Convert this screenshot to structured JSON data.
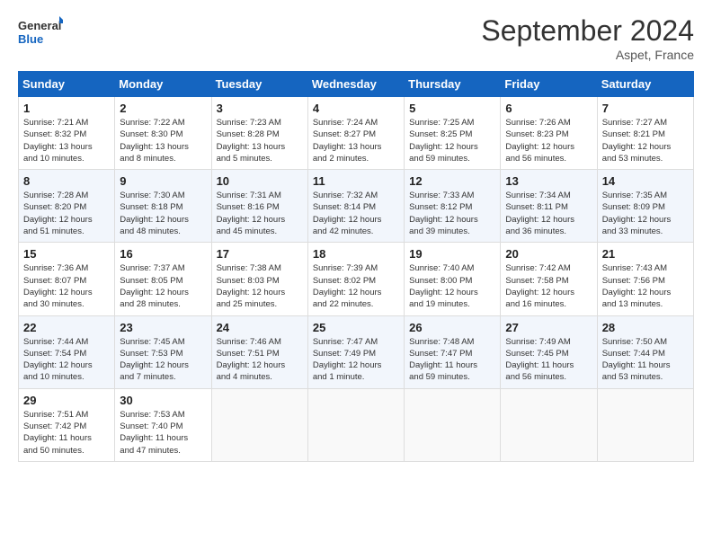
{
  "logo": {
    "line1": "General",
    "line2": "Blue"
  },
  "title": "September 2024",
  "location": "Aspet, France",
  "days_of_week": [
    "Sunday",
    "Monday",
    "Tuesday",
    "Wednesday",
    "Thursday",
    "Friday",
    "Saturday"
  ],
  "weeks": [
    [
      {
        "day": "1",
        "info": "Sunrise: 7:21 AM\nSunset: 8:32 PM\nDaylight: 13 hours\nand 10 minutes."
      },
      {
        "day": "2",
        "info": "Sunrise: 7:22 AM\nSunset: 8:30 PM\nDaylight: 13 hours\nand 8 minutes."
      },
      {
        "day": "3",
        "info": "Sunrise: 7:23 AM\nSunset: 8:28 PM\nDaylight: 13 hours\nand 5 minutes."
      },
      {
        "day": "4",
        "info": "Sunrise: 7:24 AM\nSunset: 8:27 PM\nDaylight: 13 hours\nand 2 minutes."
      },
      {
        "day": "5",
        "info": "Sunrise: 7:25 AM\nSunset: 8:25 PM\nDaylight: 12 hours\nand 59 minutes."
      },
      {
        "day": "6",
        "info": "Sunrise: 7:26 AM\nSunset: 8:23 PM\nDaylight: 12 hours\nand 56 minutes."
      },
      {
        "day": "7",
        "info": "Sunrise: 7:27 AM\nSunset: 8:21 PM\nDaylight: 12 hours\nand 53 minutes."
      }
    ],
    [
      {
        "day": "8",
        "info": "Sunrise: 7:28 AM\nSunset: 8:20 PM\nDaylight: 12 hours\nand 51 minutes."
      },
      {
        "day": "9",
        "info": "Sunrise: 7:30 AM\nSunset: 8:18 PM\nDaylight: 12 hours\nand 48 minutes."
      },
      {
        "day": "10",
        "info": "Sunrise: 7:31 AM\nSunset: 8:16 PM\nDaylight: 12 hours\nand 45 minutes."
      },
      {
        "day": "11",
        "info": "Sunrise: 7:32 AM\nSunset: 8:14 PM\nDaylight: 12 hours\nand 42 minutes."
      },
      {
        "day": "12",
        "info": "Sunrise: 7:33 AM\nSunset: 8:12 PM\nDaylight: 12 hours\nand 39 minutes."
      },
      {
        "day": "13",
        "info": "Sunrise: 7:34 AM\nSunset: 8:11 PM\nDaylight: 12 hours\nand 36 minutes."
      },
      {
        "day": "14",
        "info": "Sunrise: 7:35 AM\nSunset: 8:09 PM\nDaylight: 12 hours\nand 33 minutes."
      }
    ],
    [
      {
        "day": "15",
        "info": "Sunrise: 7:36 AM\nSunset: 8:07 PM\nDaylight: 12 hours\nand 30 minutes."
      },
      {
        "day": "16",
        "info": "Sunrise: 7:37 AM\nSunset: 8:05 PM\nDaylight: 12 hours\nand 28 minutes."
      },
      {
        "day": "17",
        "info": "Sunrise: 7:38 AM\nSunset: 8:03 PM\nDaylight: 12 hours\nand 25 minutes."
      },
      {
        "day": "18",
        "info": "Sunrise: 7:39 AM\nSunset: 8:02 PM\nDaylight: 12 hours\nand 22 minutes."
      },
      {
        "day": "19",
        "info": "Sunrise: 7:40 AM\nSunset: 8:00 PM\nDaylight: 12 hours\nand 19 minutes."
      },
      {
        "day": "20",
        "info": "Sunrise: 7:42 AM\nSunset: 7:58 PM\nDaylight: 12 hours\nand 16 minutes."
      },
      {
        "day": "21",
        "info": "Sunrise: 7:43 AM\nSunset: 7:56 PM\nDaylight: 12 hours\nand 13 minutes."
      }
    ],
    [
      {
        "day": "22",
        "info": "Sunrise: 7:44 AM\nSunset: 7:54 PM\nDaylight: 12 hours\nand 10 minutes."
      },
      {
        "day": "23",
        "info": "Sunrise: 7:45 AM\nSunset: 7:53 PM\nDaylight: 12 hours\nand 7 minutes."
      },
      {
        "day": "24",
        "info": "Sunrise: 7:46 AM\nSunset: 7:51 PM\nDaylight: 12 hours\nand 4 minutes."
      },
      {
        "day": "25",
        "info": "Sunrise: 7:47 AM\nSunset: 7:49 PM\nDaylight: 12 hours\nand 1 minute."
      },
      {
        "day": "26",
        "info": "Sunrise: 7:48 AM\nSunset: 7:47 PM\nDaylight: 11 hours\nand 59 minutes."
      },
      {
        "day": "27",
        "info": "Sunrise: 7:49 AM\nSunset: 7:45 PM\nDaylight: 11 hours\nand 56 minutes."
      },
      {
        "day": "28",
        "info": "Sunrise: 7:50 AM\nSunset: 7:44 PM\nDaylight: 11 hours\nand 53 minutes."
      }
    ],
    [
      {
        "day": "29",
        "info": "Sunrise: 7:51 AM\nSunset: 7:42 PM\nDaylight: 11 hours\nand 50 minutes."
      },
      {
        "day": "30",
        "info": "Sunrise: 7:53 AM\nSunset: 7:40 PM\nDaylight: 11 hours\nand 47 minutes."
      },
      {
        "day": "",
        "info": ""
      },
      {
        "day": "",
        "info": ""
      },
      {
        "day": "",
        "info": ""
      },
      {
        "day": "",
        "info": ""
      },
      {
        "day": "",
        "info": ""
      }
    ]
  ]
}
